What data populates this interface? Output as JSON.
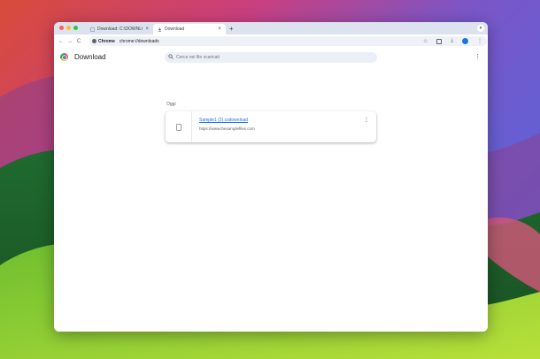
{
  "tabs": [
    {
      "title": "Download: C:\\DOWNLOAD su",
      "close": "×",
      "active": false
    },
    {
      "title": "Download",
      "close": "×",
      "active": true
    }
  ],
  "tabstrip": {
    "new_tab": "+",
    "menu": "▾"
  },
  "toolbar": {
    "back": "←",
    "forward": "→",
    "reload": "C",
    "chip_label": "Chrome",
    "url": "chrome://downloads",
    "star": "☆",
    "download": "⤓",
    "menu": "⋮"
  },
  "page": {
    "title": "Download",
    "search_placeholder": "Cerca nei file scaricati",
    "menu": "⋮"
  },
  "downloads": {
    "section_label": "Oggi",
    "items": [
      {
        "name": "Sample1 (2).csdownload",
        "url": "https://www.thesamplefiles.com",
        "menu": "⋮"
      }
    ]
  },
  "colors": {
    "accent": "#1a73e8",
    "tabstrip": "#dde3ee",
    "omnibox": "#eef1f6"
  }
}
